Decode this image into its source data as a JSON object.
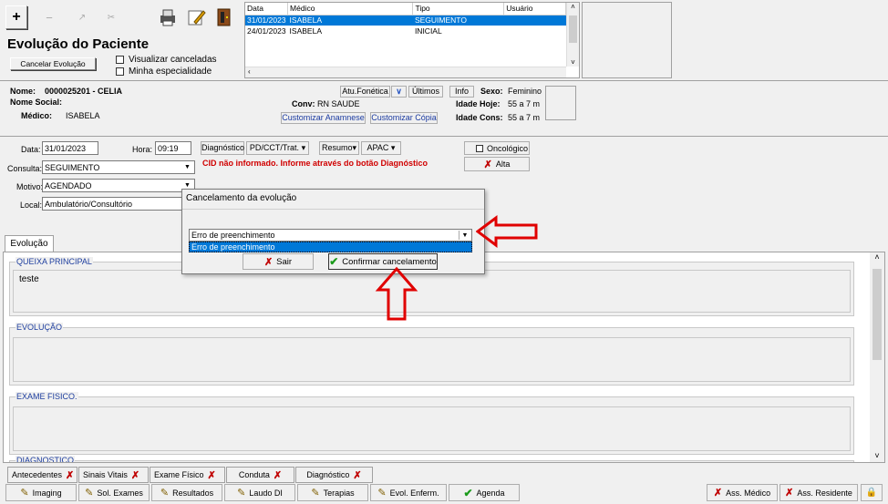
{
  "window": {
    "title": "Evolução do Paciente"
  },
  "toolbar": {
    "icons": [
      "plus-icon",
      "minus-icon",
      "chart-icon",
      "scissors-icon",
      "printer-icon",
      "edit-icon",
      "exit-door-icon"
    ],
    "cancel_label": "Cancelar Evolução",
    "show_cancelled_label": "Visualizar canceladas",
    "my_specialty_label": "Minha especialidade"
  },
  "grid": {
    "headers": [
      "Data",
      "Médico",
      "Tipo",
      "Usuário"
    ],
    "rows": [
      {
        "data": "31/01/2023",
        "medico": "ISABELA",
        "tipo": "SEGUIMENTO",
        "usuario": ""
      },
      {
        "data": "24/01/2023",
        "medico": "ISABELA",
        "tipo": "INICIAL",
        "usuario": ""
      }
    ]
  },
  "patient": {
    "nome_label": "Nome:",
    "nome_value": "0000025201 - CELIA",
    "nome_social_label": "Nome Social:",
    "medico_label": "Médico:",
    "medico_value": "ISABELA",
    "atu_fonetica": "Atu.Fonética",
    "ultimos": "Últimos",
    "info": "Info",
    "sexo_label": "Sexo:",
    "sexo_value": "Feminino",
    "conv_label": "Conv:",
    "conv_value": "RN SAUDE",
    "idade_hoje_label": "Idade Hoje:",
    "idade_hoje_value": "55 a 7 m",
    "idade_cons_label": "Idade Cons:",
    "idade_cons_value": "55 a 7 m",
    "customizar_anamnese": "Customizar Anamnese",
    "customizar_copia": "Customizar Cópia"
  },
  "form": {
    "data_label": "Data:",
    "data_value": "31/01/2023",
    "hora_label": "Hora:",
    "hora_value": "09:19",
    "consulta_label": "Consulta:",
    "consulta_value": "SEGUIMENTO",
    "motivo_label": "Motivo:",
    "motivo_value": "AGENDADO",
    "local_label": "Local:",
    "local_value": "Ambulatório/Consultório",
    "diagnostico_btn": "Diagnóstico",
    "pdcct_btn": "PD/CCT/Trat.",
    "resumo_btn": "Resumo",
    "apac_btn": "APAC",
    "oncologico_label": "Oncológico",
    "alta_btn": "Alta",
    "cid_warning": "CID não informado. Informe através do botão Diagnóstico",
    "warning_color": "#d00000"
  },
  "dialog": {
    "title": "Cancelamento da evolução",
    "selected": "Erro de preenchimento",
    "option": "Erro de preenchimento",
    "sair": "Sair",
    "confirmar": "Confirmar cancelamento"
  },
  "tabs": {
    "evolucao": "Evolução"
  },
  "sections": {
    "queixa": {
      "title": "QUEIXA PRINCIPAL",
      "text": "teste"
    },
    "evolucao": {
      "title": "EVOLUÇÃO"
    },
    "exame": {
      "title": "EXAME FISICO."
    },
    "diagnostico": {
      "title": "DIAGNOSTICO"
    }
  },
  "bottom_tabs": [
    "Antecedentes",
    "Sinais Vitais",
    "Exame Físico",
    "Conduta",
    "Diagnóstico"
  ],
  "bottom_buttons": [
    "Imaging",
    "Sol. Exames",
    "Resultados",
    "Laudo DI",
    "Terapias",
    "Evol. Enferm.",
    "Agenda"
  ],
  "sign_buttons": [
    "Ass. Médico",
    "Ass. Residente"
  ],
  "accent_color": "#0078d7"
}
